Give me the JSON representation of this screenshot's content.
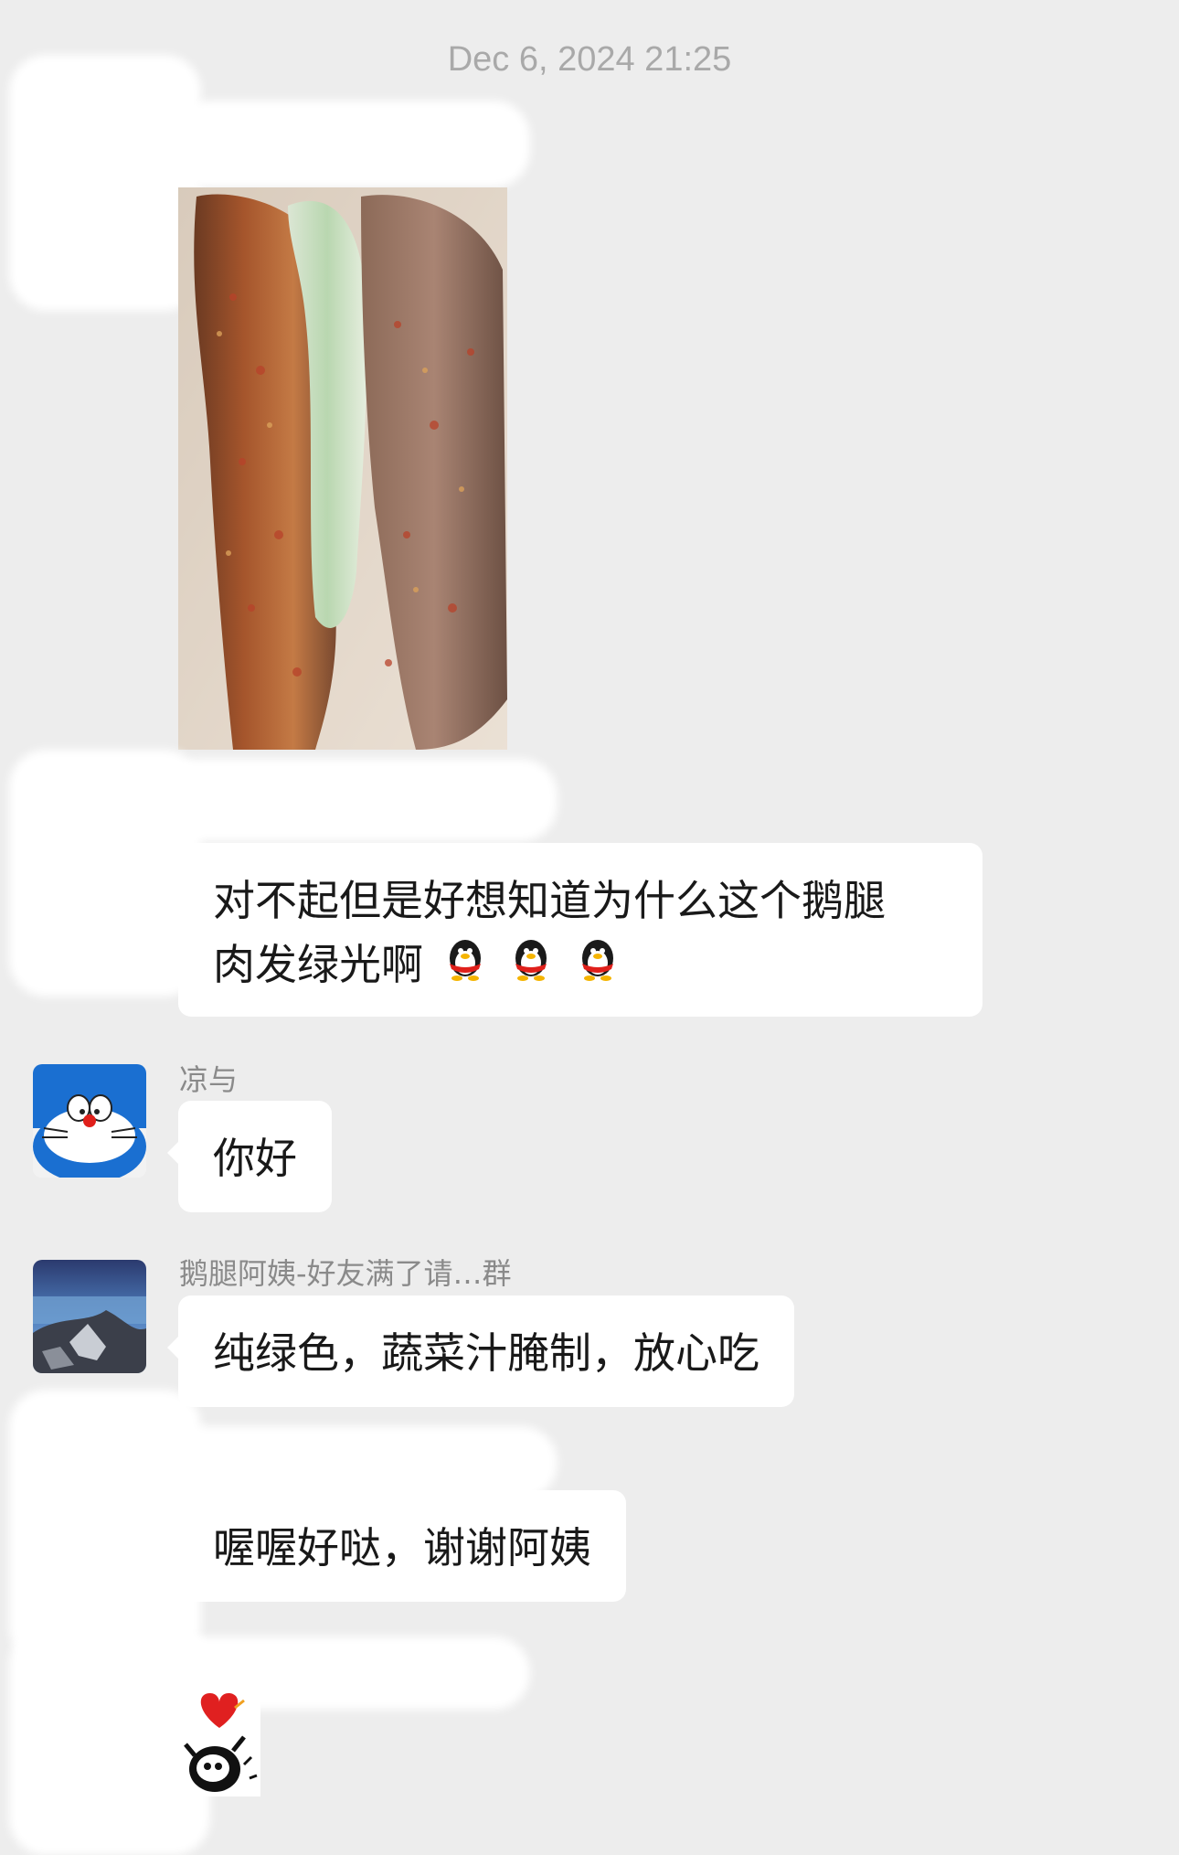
{
  "timestamp": "Dec 6, 2024 21:25",
  "messages": [
    {
      "id": "m1",
      "type": "image",
      "sender": "",
      "alt": ""
    },
    {
      "id": "m2",
      "type": "text",
      "sender": "",
      "text_line1": "对不起但是好想知道为什么这个鹅腿",
      "text_line2": "肉发绿光啊"
    },
    {
      "id": "m3",
      "type": "text",
      "sender": "凉与",
      "text": "你好"
    },
    {
      "id": "m4",
      "type": "text",
      "sender": "鹅腿阿姨-好友满了请…群",
      "text": "纯绿色，蔬菜汁腌制，放心吃"
    },
    {
      "id": "m5",
      "type": "text",
      "sender": "",
      "text": "喔喔好哒，谢谢阿姨"
    },
    {
      "id": "m6",
      "type": "sticker",
      "sender": ""
    }
  ],
  "emoji": {
    "name": "qq-penguin-icon",
    "count": 3
  },
  "colors": {
    "background": "#ededed",
    "bubble": "#ffffff",
    "timestamp": "#a9a9a9",
    "sender": "#8a8a8a"
  }
}
